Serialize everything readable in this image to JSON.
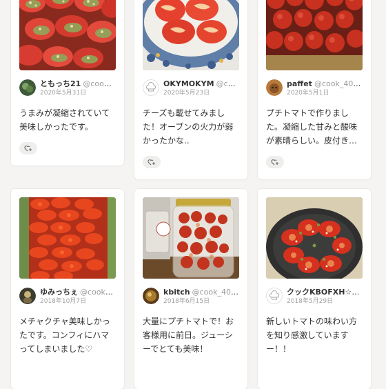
{
  "cards": [
    {
      "user_name": "ともっち21",
      "user_id": "@cook_...",
      "date": "2020年5月31日",
      "comment": "うまみが凝縮されていて美味しかったです。",
      "like_icon": "heart-plus-icon",
      "photo_subject": "stuffed-tomatoes-with-herbs"
    },
    {
      "user_name": "OKYMOKYM",
      "user_id": "@cook...",
      "date": "2020年5月23日",
      "comment": "チーズも載せてみました！オーブンの火力が弱かったかな..",
      "like_icon": "heart-plus-icon",
      "photo_subject": "tomatoes-with-cheese-on-plate"
    },
    {
      "user_name": "paffet",
      "user_id": "@cook_4016...",
      "date": "2020年5月1日",
      "comment": "プチトマトで作りました。凝縮した甘みと酸味が素晴らしい。皮付き…",
      "like_icon": "heart-plus-icon",
      "photo_subject": "roasted-cherry-tomatoes"
    },
    {
      "user_name": "ゆみっちぇ",
      "user_id": "@cook_4...",
      "date": "2018年10月7日",
      "comment": "メチャクチャ美味しかったです。コンフィにハマってしまいました♡",
      "like_icon": "heart-plus-icon",
      "photo_subject": "tomato-slices-on-tray"
    },
    {
      "user_name": "kbitch",
      "user_id": "@cook_4004...",
      "date": "2018年6月15日",
      "comment": "大量にプチトマトで！お客様用に前日。ジューシーでとても美味！",
      "like_icon": "heart-plus-icon",
      "photo_subject": "tomatoes-in-glass-jar"
    },
    {
      "user_name": "クックKBOFXH☆",
      "user_id": "@...",
      "date": "2018年5月29日",
      "comment": "新しいトマトの味わい方を知り感激していますー！！",
      "like_icon": "heart-plus-icon",
      "photo_subject": "sliced-tomatoes-on-dark-plate"
    }
  ],
  "colors": {
    "background": "#f5f4f2",
    "card": "#ffffff",
    "muted_text": "#9a9a9a",
    "like_bg": "#eeeeec"
  }
}
